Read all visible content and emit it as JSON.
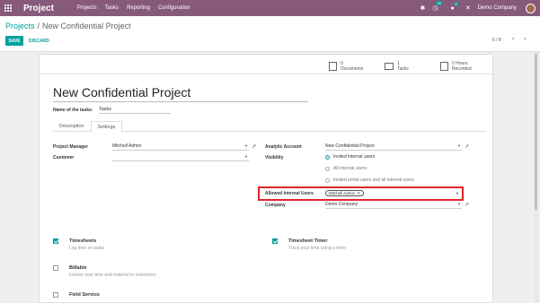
{
  "navbar": {
    "brand": "Project",
    "menu": [
      "Projects",
      "Tasks",
      "Reporting",
      "Configuration"
    ],
    "chat_badge": "26",
    "activity_badge": "5",
    "company": "Demo Company"
  },
  "breadcrumb": {
    "parent": "Projects",
    "separator": "/",
    "current": "New Confidential Project"
  },
  "actions": {
    "save": "SAVE",
    "discard": "DISCARD"
  },
  "pager": {
    "value": "6 / 8"
  },
  "stats": [
    {
      "value": "0",
      "label": "Documents"
    },
    {
      "value": "1",
      "label": "Tasks"
    },
    {
      "value": "0 Hours",
      "label": "Recorded"
    }
  ],
  "form": {
    "title": "New Confidential Project",
    "tasks_label": "Name of the tasks:",
    "tasks_value": "Tasks",
    "tabs": [
      "Description",
      "Settings"
    ],
    "project_manager_label": "Project Manager",
    "project_manager_value": "Mitchell Admin",
    "customer_label": "Customer",
    "customer_value": "",
    "analytic_label": "Analytic Account",
    "analytic_value": "New Confidential Project",
    "visibility_label": "Visibility",
    "visibility_options": [
      "Invited internal users",
      "All internal users",
      "Invited portal users and all internal users"
    ],
    "allowed_label": "Allowed Internal Users",
    "allowed_tag": "Mitchell Admin",
    "company_label": "Company",
    "company_value": "Demo Company"
  },
  "options": [
    {
      "title": "Timesheets",
      "desc": "Log time on tasks"
    },
    {
      "title": "Timesheet Timer",
      "desc": "Track your time using a timer"
    },
    {
      "title": "Billable",
      "desc": "Invoice your time and material to customers"
    },
    {
      "title": "Field Service",
      "desc": ""
    }
  ],
  "colors": {
    "navbar": "#875a7b",
    "accent": "#00a09d",
    "highlight": "#e0252a"
  }
}
